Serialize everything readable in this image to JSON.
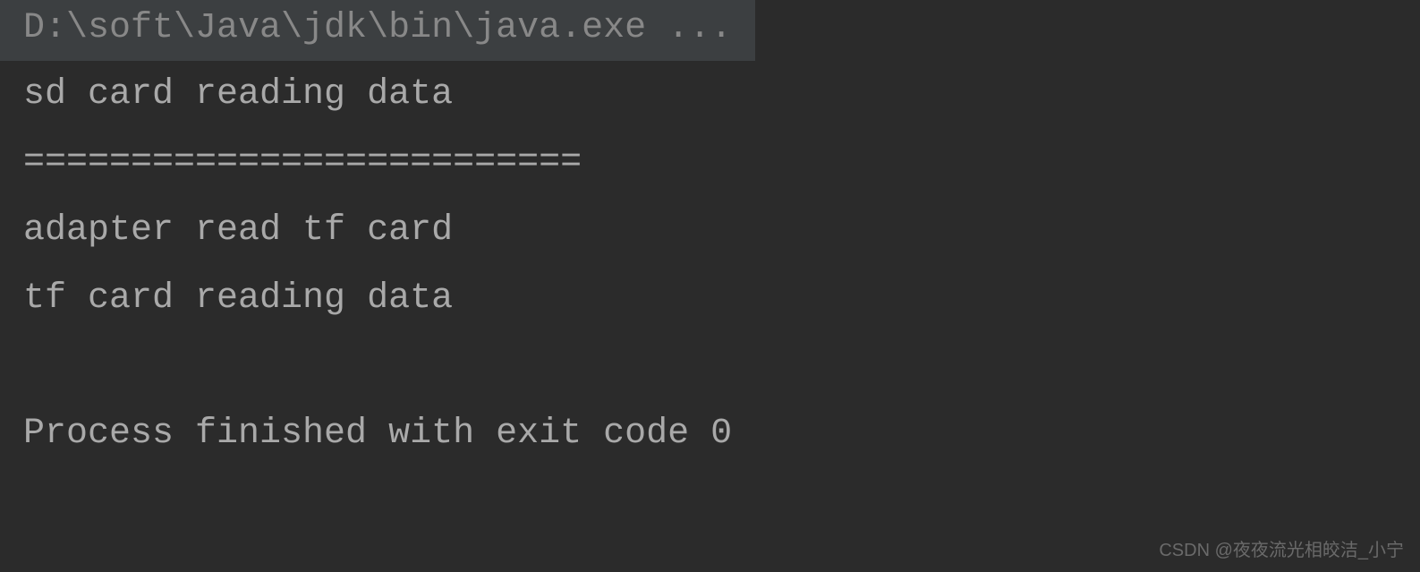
{
  "console": {
    "command": "D:\\soft\\Java\\jdk\\bin\\java.exe ...",
    "lines": [
      "sd card reading data",
      "==========================",
      "adapter read tf card",
      "tf card reading data"
    ],
    "exit_message": "Process finished with exit code 0"
  },
  "watermark": "CSDN @夜夜流光相皎洁_小宁"
}
